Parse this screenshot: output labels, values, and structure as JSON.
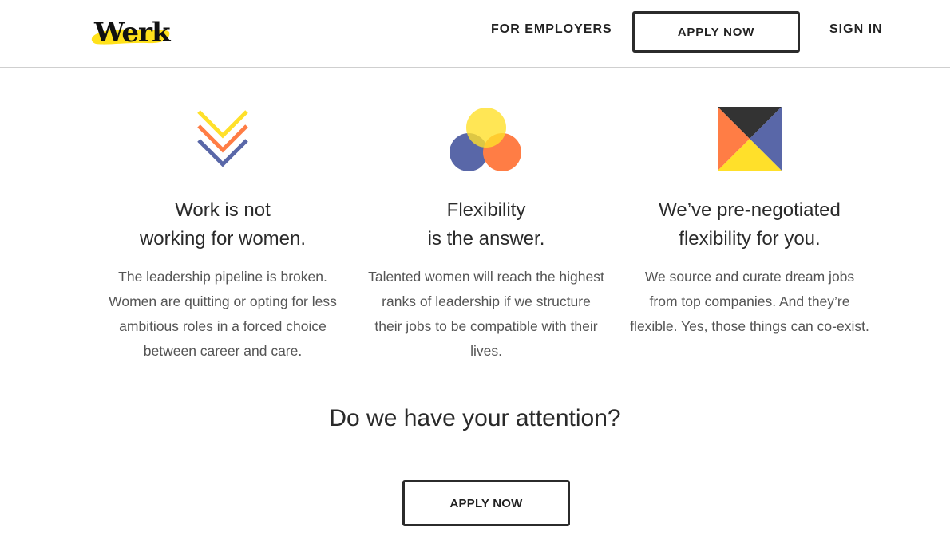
{
  "brand": {
    "name": "Werk",
    "highlight_color": "#ffe11a"
  },
  "nav": {
    "employers_label": "FOR EMPLOYERS",
    "apply_label": "APPLY NOW",
    "signin_label": "SIGN IN"
  },
  "features": [
    {
      "icon": "chevrons-icon",
      "title_line1": "Work is not",
      "title_line2": "working for women.",
      "body": "The leadership pipeline is broken. Women are quitting or opting for less ambitious roles in a forced choice between career and care."
    },
    {
      "icon": "venn-circles-icon",
      "title_line1": "Flexibility",
      "title_line2": "is the answer.",
      "body": "Talented women will reach the highest ranks of leadership if we structure their jobs to be compatible with their lives."
    },
    {
      "icon": "split-square-icon",
      "title_line1": "We’ve pre-negotiated",
      "title_line2": "flexibility for you.",
      "body": "We source and curate dream jobs from top companies. And they’re flexible. Yes, those things can co-exist."
    }
  ],
  "cta": {
    "heading": "Do we have your attention?",
    "button_label": "APPLY NOW"
  },
  "colors": {
    "yellow": "#ffe02a",
    "orange": "#ff7d45",
    "blue": "#5967a8",
    "dark": "#333333"
  }
}
